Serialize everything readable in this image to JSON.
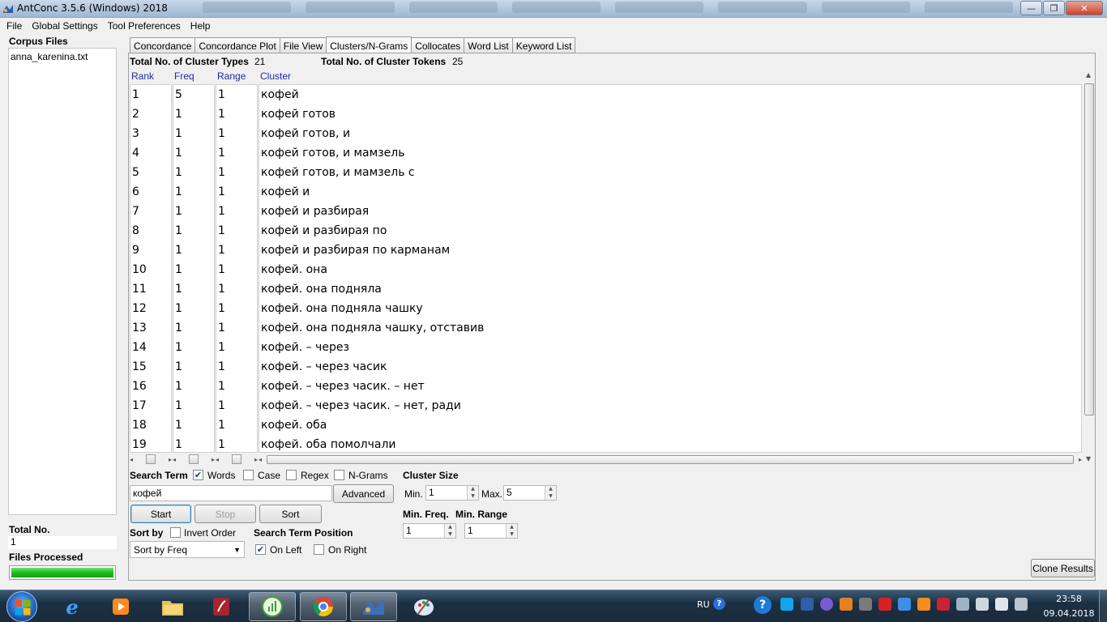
{
  "window": {
    "title": "AntConc 3.5.6 (Windows) 2018",
    "minimize": "—",
    "maximize": "❐",
    "close": "✕"
  },
  "menu": [
    "File",
    "Global Settings",
    "Tool Preferences",
    "Help"
  ],
  "left_panel": {
    "corpus_files_label": "Corpus Files",
    "files": [
      "anna_karenina.txt"
    ],
    "total_no_label": "Total No.",
    "total_no_value": "1",
    "files_processed_label": "Files Processed",
    "progress": 1.0
  },
  "tabs": [
    "Concordance",
    "Concordance Plot",
    "File View",
    "Clusters/N-Grams",
    "Collocates",
    "Word List",
    "Keyword List"
  ],
  "active_tab": "Clusters/N-Grams",
  "stats": {
    "types_label": "Total No. of Cluster Types",
    "types_value": "21",
    "tokens_label": "Total No. of Cluster Tokens",
    "tokens_value": "25"
  },
  "columns": {
    "rank": "Rank",
    "freq": "Freq",
    "range": "Range",
    "cluster": "Cluster"
  },
  "rows": [
    {
      "rank": "1",
      "freq": "5",
      "range": "1",
      "cluster": "кофей"
    },
    {
      "rank": "2",
      "freq": "1",
      "range": "1",
      "cluster": "кофей готов"
    },
    {
      "rank": "3",
      "freq": "1",
      "range": "1",
      "cluster": "кофей готов, и"
    },
    {
      "rank": "4",
      "freq": "1",
      "range": "1",
      "cluster": "кофей готов, и мамзель"
    },
    {
      "rank": "5",
      "freq": "1",
      "range": "1",
      "cluster": "кофей готов, и мамзель с"
    },
    {
      "rank": "6",
      "freq": "1",
      "range": "1",
      "cluster": "кофей и"
    },
    {
      "rank": "7",
      "freq": "1",
      "range": "1",
      "cluster": "кофей и разбирая"
    },
    {
      "rank": "8",
      "freq": "1",
      "range": "1",
      "cluster": "кофей и разбирая по"
    },
    {
      "rank": "9",
      "freq": "1",
      "range": "1",
      "cluster": "кофей и разбирая по карманам"
    },
    {
      "rank": "10",
      "freq": "1",
      "range": "1",
      "cluster": "кофей.  она"
    },
    {
      "rank": "11",
      "freq": "1",
      "range": "1",
      "cluster": "кофей.  она подняла"
    },
    {
      "rank": "12",
      "freq": "1",
      "range": "1",
      "cluster": "кофей.  она подняла чашку"
    },
    {
      "rank": "13",
      "freq": "1",
      "range": "1",
      "cluster": "кофей.  она подняла чашку, отставив"
    },
    {
      "rank": "14",
      "freq": "1",
      "range": "1",
      "cluster": "кофей.  – через"
    },
    {
      "rank": "15",
      "freq": "1",
      "range": "1",
      "cluster": "кофей.  – через часик"
    },
    {
      "rank": "16",
      "freq": "1",
      "range": "1",
      "cluster": "кофей.  – через часик.  – нет"
    },
    {
      "rank": "17",
      "freq": "1",
      "range": "1",
      "cluster": "кофей.  – через часик.  – нет, ради"
    },
    {
      "rank": "18",
      "freq": "1",
      "range": "1",
      "cluster": "кофей. оба"
    },
    {
      "rank": "19",
      "freq": "1",
      "range": "1",
      "cluster": "кофей. оба помолчали"
    }
  ],
  "search": {
    "label": "Search Term",
    "words_label": "Words",
    "case_label": "Case",
    "regex_label": "Regex",
    "ngrams_label": "N-Grams",
    "term": "кофей",
    "advanced_label": "Advanced",
    "words_checked": true,
    "case_checked": false,
    "regex_checked": false,
    "ngrams_checked": false
  },
  "buttons": {
    "start": "Start",
    "stop": "Stop",
    "sort": "Sort",
    "clone": "Clone Results"
  },
  "sort": {
    "sort_by_label": "Sort by",
    "invert_label": "Invert Order",
    "selected": "Sort by Freq",
    "position_label": "Search Term Position",
    "on_left_label": "On Left",
    "on_right_label": "On Right",
    "on_left_checked": true,
    "on_right_checked": false
  },
  "cluster_size": {
    "label": "Cluster Size",
    "min_label": "Min.",
    "min_value": "1",
    "max_label": "Max.",
    "max_value": "5",
    "min_freq_label": "Min. Freq.",
    "min_freq_value": "1",
    "min_range_label": "Min. Range",
    "min_range_value": "1"
  },
  "taskbar": {
    "lang": "RU",
    "time": "23:58",
    "date": "09.04.2018",
    "apps": [
      "start-orb",
      "ie-icon",
      "media-player-icon",
      "explorer-icon",
      "reader-icon",
      "monitor-icon",
      "chrome-icon",
      "antconc-icon",
      "paint-icon"
    ]
  },
  "colors": {
    "header_blue": "#1e2aa8",
    "progress_green": "#1dbb1d",
    "taskbar": "#1c2f42"
  }
}
